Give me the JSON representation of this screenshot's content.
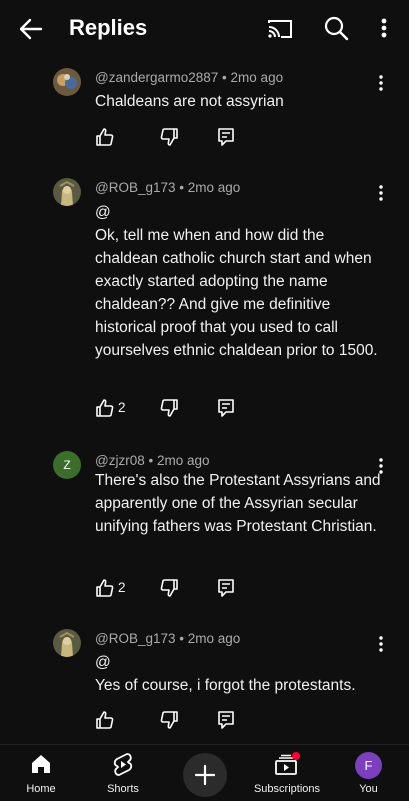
{
  "header": {
    "title": "Replies"
  },
  "comments": [
    {
      "author": "@zandergarmo2887",
      "age": "2mo ago",
      "lines": [
        "Chaldeans are not assyrian"
      ],
      "likes": ""
    },
    {
      "author": "@ROB_g173",
      "age": "2mo ago",
      "lines": [
        "@",
        "Ok, tell me when and how did the chaldean catholic church start and when exactly started adopting the name chaldean?? And give me definitive historical proof that you used to call yourselves ethnic chaldean prior to 1500."
      ],
      "likes": "2"
    },
    {
      "author": "@zjzr08",
      "avatar_letter": "Z",
      "age": "2mo ago",
      "lines": [
        "There's also the Protestant Assyrians and apparently one of the Assyrian secular unifying fathers was Protestant Christian."
      ],
      "likes": "2"
    },
    {
      "author": "@ROB_g173",
      "age": "2mo ago",
      "lines": [
        "@",
        "Yes of course, i forgot the protestants."
      ],
      "likes": ""
    }
  ],
  "meta_sep": "•",
  "nav": {
    "home": "Home",
    "shorts": "Shorts",
    "subscriptions": "Subscriptions",
    "you": "You",
    "you_letter": "F"
  },
  "colors": {
    "background": "#0f0f0f",
    "text": "#f1f1f1",
    "meta": "#aaaaaa",
    "you_avatar": "#7b3fbf",
    "notification": "#ff0033"
  }
}
